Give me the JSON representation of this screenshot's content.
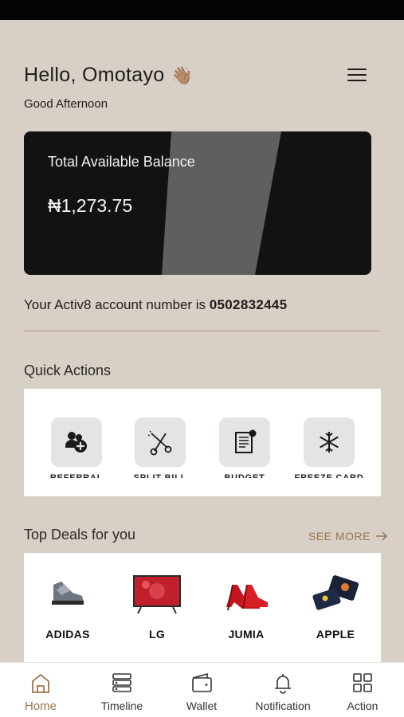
{
  "header": {
    "greeting": "Hello, Omotayo",
    "greeting_emoji": "👋🏽",
    "subtitle": "Good Afternoon",
    "menu_icon": "hamburger-menu-icon"
  },
  "balance_card": {
    "label": "Total Available Balance",
    "amount": "₦1,273.75"
  },
  "account": {
    "prefix": "Your Activ8 account number is",
    "number": "0502832445"
  },
  "quick_actions": {
    "title": "Quick Actions",
    "items": [
      {
        "label": "REFERRAL",
        "icon": "referral-icon"
      },
      {
        "label": "SPLIT BILL",
        "icon": "scissors-icon"
      },
      {
        "label": "BUDGET",
        "icon": "budget-icon"
      },
      {
        "label": "FREEZE CARD",
        "icon": "snowflake-icon"
      }
    ]
  },
  "deals": {
    "title": "Top Deals for you",
    "see_more": "SEE MORE",
    "items": [
      {
        "name": "ADIDAS",
        "icon": "sneaker-image"
      },
      {
        "name": "LG",
        "icon": "tv-image"
      },
      {
        "name": "JUMIA",
        "icon": "heels-image"
      },
      {
        "name": "APPLE",
        "icon": "apple-card-image"
      }
    ]
  },
  "tabbar": {
    "items": [
      {
        "label": "Home",
        "icon": "home-icon",
        "active": true
      },
      {
        "label": "Timeline",
        "icon": "timeline-icon"
      },
      {
        "label": "Wallet",
        "icon": "wallet-icon"
      },
      {
        "label": "Notification",
        "icon": "bell-icon"
      },
      {
        "label": "Action",
        "icon": "grid-icon"
      }
    ]
  },
  "colors": {
    "background": "#d8cfc6",
    "card": "#121212",
    "accent": "#a0764a",
    "divider": "#b89a86"
  }
}
